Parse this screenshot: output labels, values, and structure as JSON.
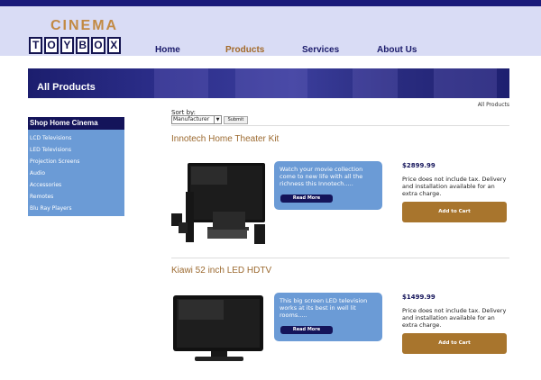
{
  "logo": {
    "cinema": "CINEMA",
    "toybox": [
      "T",
      "O",
      "Y",
      "B",
      "O",
      "X"
    ]
  },
  "nav": {
    "home": "Home",
    "products": "Products",
    "services": "Services",
    "about": "About Us"
  },
  "banner": {
    "title": "All Products"
  },
  "breadcrumb": "All Products",
  "sidebar": {
    "heading": "Shop Home Cinema",
    "items": [
      {
        "label": "LCD Televisions"
      },
      {
        "label": "LED Televisions"
      },
      {
        "label": "Projection Screens"
      },
      {
        "label": "Audio"
      },
      {
        "label": "Accessories"
      },
      {
        "label": "Remotes"
      },
      {
        "label": "Blu Ray Players"
      }
    ]
  },
  "sort": {
    "label": "Sort by:",
    "selected": "Manufacturer",
    "submit_label": "Submit"
  },
  "products": [
    {
      "name": "Innotech Home Theater Kit",
      "description": "Watch your movie collection come to new life with all the richness this Innotech.....",
      "read_more": "Read More",
      "price": "$2899.99",
      "price_note": "Price does not include tax. Delivery and installation available for an extra charge.",
      "cart_label": "Add to Cart"
    },
    {
      "name": "Kiawi 52 inch LED HDTV",
      "description": "This big screen LED television works at its best in well lit rooms.....",
      "read_more": "Read More",
      "price": "$1499.99",
      "price_note": "Price does not include tax. Delivery and installation available for an extra charge.",
      "cart_label": "Add to Cart"
    }
  ]
}
